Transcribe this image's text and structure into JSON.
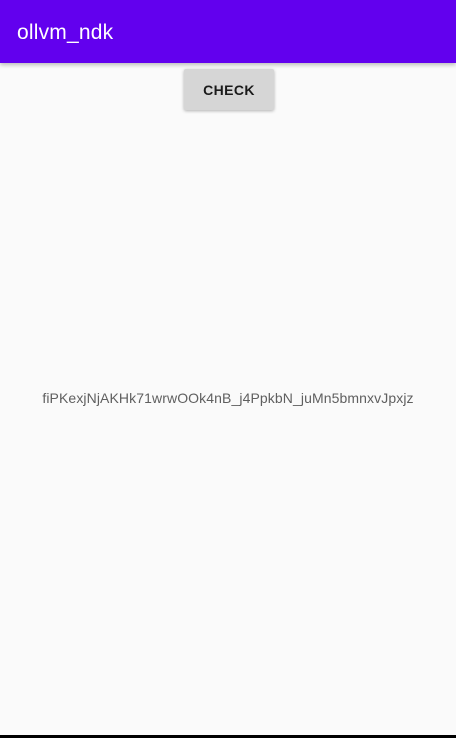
{
  "app_bar": {
    "title": "ollvm_ndk"
  },
  "main": {
    "check_button_label": "CHECK",
    "result_text": "fiPKexjNjAKHk71wrwOOk4nB_j4PpkbN_juMn5bmnxvJpxjz"
  },
  "colors": {
    "app_bar": "#6200ee",
    "background": "#fafafa",
    "button": "#d6d6d6"
  }
}
